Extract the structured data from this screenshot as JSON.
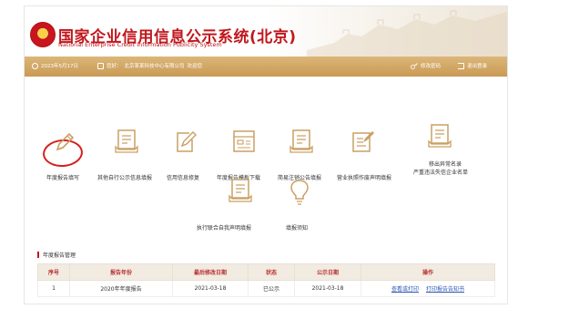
{
  "header": {
    "title_cn": "国家企业信用信息公示系统(北京)",
    "title_en": "National Enterprise Credit Information Publicity System"
  },
  "topbar": {
    "date": "2023年5月17日",
    "user_label": "您好：",
    "user_name": "北京某某科技中心有限公司",
    "user_suffix": "欢迎您",
    "change_password": "修改密码",
    "logout": "退出登录"
  },
  "functions": [
    {
      "label": "年度报告填写",
      "icon": "pen-write-icon"
    },
    {
      "label": "其他自行公示信息填报",
      "icon": "form-list-icon"
    },
    {
      "label": "信用信息修复",
      "icon": "edit-doc-icon"
    },
    {
      "label": "年度报告模板下载",
      "icon": "template-icon"
    },
    {
      "label": "简易注销公告填报",
      "icon": "notice-icon"
    },
    {
      "label": "营业执照作废声明填报",
      "icon": "license-edit-icon"
    },
    {
      "label_line1": "移出异常名录",
      "label_line2": "严重违法失信企业名单",
      "icon": "removal-list-icon"
    },
    {
      "label": "执行联合自我声明填报",
      "icon": "statement-icon"
    },
    {
      "label": "填报须知",
      "icon": "lightbulb-icon"
    }
  ],
  "section": {
    "title": "年度报告管理"
  },
  "table": {
    "headers": [
      "序号",
      "报告年份",
      "最后修改日期",
      "状态",
      "公示日期",
      "操作"
    ],
    "rows": [
      {
        "index": "1",
        "year": "2020年年度报告",
        "modified": "2021-03-18",
        "status": "已公示",
        "published": "2021-03-18",
        "action1": "查看或打印",
        "action2": "打印报告告知书"
      }
    ]
  },
  "colors": {
    "brand_red": "#c0171c",
    "topbar_gold": "#d4a96a",
    "icon_gold": "#c9a063",
    "link_blue": "#2a56b5",
    "highlight_circle": "#d81e1e"
  }
}
